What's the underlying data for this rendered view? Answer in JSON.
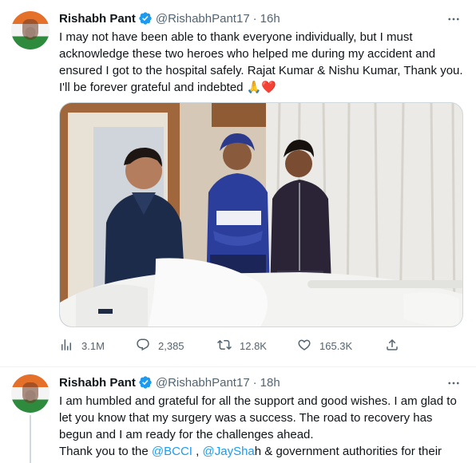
{
  "tweets": [
    {
      "author": {
        "name": "Rishabh Pant",
        "handle": "@RishabhPant17",
        "verified": true
      },
      "time": "16h",
      "text": [
        "I may not have been able to thank everyone individually, but I must",
        "acknowledge these two heroes who helped me during my accident and",
        "ensured I got to the hospital safely. Rajat Kumar & Nishu Kumar, Thank you.",
        "I'll be forever grateful and indebted 🙏❤️"
      ],
      "stats": {
        "views": "3.1M",
        "replies": "2,385",
        "retweets": "12.8K",
        "likes": "165.3K"
      }
    },
    {
      "author": {
        "name": "Rishabh Pant",
        "handle": "@RishabhPant17",
        "verified": true
      },
      "time": "18h",
      "text": [
        "I am humbled and grateful for all the support and good wishes. I am glad to",
        "let you know that my surgery was a success. The road to recovery has",
        "begun and I am ready for the challenges ahead."
      ],
      "text_last": {
        "prefix": "Thank you to the ",
        "mention1": "@BCCI",
        "middle": " , ",
        "mention2": "@JaySha",
        "suffix": "h & government authorities for their"
      }
    }
  ],
  "icons": {
    "more": "more-horizontal-icon",
    "verified": "verified-badge-icon",
    "views": "analytics-icon",
    "reply": "reply-icon",
    "retweet": "retweet-icon",
    "like": "heart-icon",
    "share": "share-icon"
  },
  "colors": {
    "accent": "#1d9bf0",
    "muted": "#536471",
    "text": "#0f1419"
  }
}
